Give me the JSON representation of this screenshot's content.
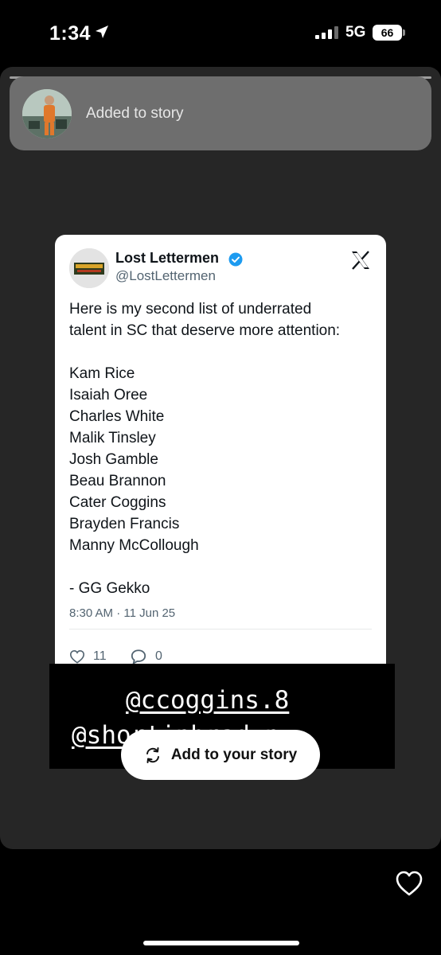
{
  "status_bar": {
    "time": "1:34",
    "network": "5G",
    "battery": "66",
    "icons": [
      "location-arrow-icon",
      "signal-icon"
    ]
  },
  "toast": {
    "text": "Added to story"
  },
  "tweet": {
    "author_name": "Lost Lettermen",
    "handle": "@LostLettermen",
    "verified": true,
    "intro_lines": [
      "Here is my second list of underrated",
      "talent in SC that deserve more attention:"
    ],
    "players": [
      "Kam Rice",
      "Isaiah Oree",
      "Charles White",
      "Malik Tinsley",
      "Josh Gamble",
      "Beau Brannon",
      "Cater Coggins",
      "Brayden Francis",
      "Manny McCollough"
    ],
    "signature": "- GG Gekko",
    "timestamp": "8:30 AM · 11 Jun 25",
    "likes": "11",
    "replies": "0",
    "accent_color": "#1d9bf0"
  },
  "mentions": {
    "first": "@ccoggins.8",
    "second": "@shortinbradyn"
  },
  "add_story": {
    "label": "Add to your story"
  }
}
